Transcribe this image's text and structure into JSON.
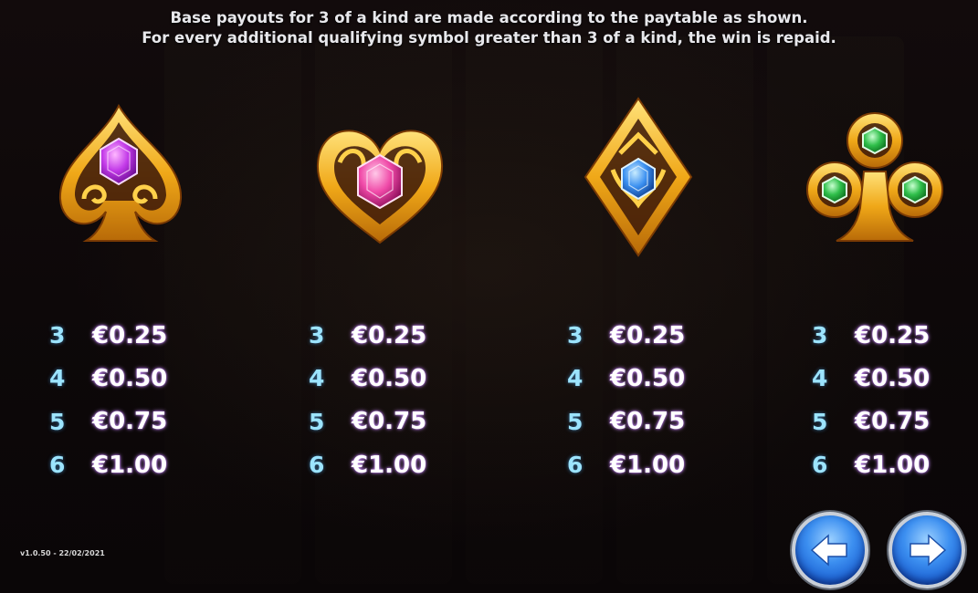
{
  "info": {
    "line1": "Base payouts for 3 of a kind are made according to the paytable as shown.",
    "line2": "For every additional qualifying symbol greater than 3 of a kind, the win is repaid."
  },
  "symbols": [
    {
      "icon": "gold-spade-purple-gem-icon",
      "gem_color": "#c23ae8",
      "pays": [
        {
          "count": "3",
          "value": "€0.25"
        },
        {
          "count": "4",
          "value": "€0.50"
        },
        {
          "count": "5",
          "value": "€0.75"
        },
        {
          "count": "6",
          "value": "€1.00"
        }
      ]
    },
    {
      "icon": "gold-heart-pink-gem-icon",
      "gem_color": "#f04aa8",
      "pays": [
        {
          "count": "3",
          "value": "€0.25"
        },
        {
          "count": "4",
          "value": "€0.50"
        },
        {
          "count": "5",
          "value": "€0.75"
        },
        {
          "count": "6",
          "value": "€1.00"
        }
      ]
    },
    {
      "icon": "gold-diamond-blue-gem-icon",
      "gem_color": "#3a8ff0",
      "pays": [
        {
          "count": "3",
          "value": "€0.25"
        },
        {
          "count": "4",
          "value": "€0.50"
        },
        {
          "count": "5",
          "value": "€0.75"
        },
        {
          "count": "6",
          "value": "€1.00"
        }
      ]
    },
    {
      "icon": "gold-club-green-gem-icon",
      "gem_color": "#2fbf4a",
      "pays": [
        {
          "count": "3",
          "value": "€0.25"
        },
        {
          "count": "4",
          "value": "€0.50"
        },
        {
          "count": "5",
          "value": "€0.75"
        },
        {
          "count": "6",
          "value": "€1.00"
        }
      ]
    }
  ],
  "version": "v1.0.50 - 22/02/2021",
  "nav": {
    "prev_icon": "arrow-left-icon",
    "next_icon": "arrow-right-icon"
  },
  "colors": {
    "gold": "#f0b020",
    "count_text": "#9ce4ff",
    "button_blue": "#2a74e4"
  }
}
